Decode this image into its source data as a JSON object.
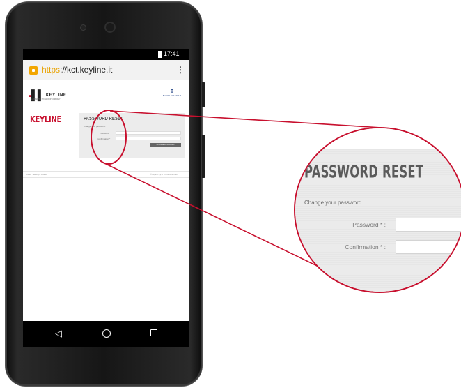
{
  "status_bar": {
    "time": "17:41"
  },
  "browser": {
    "url_protocol": "https",
    "url_rest": "://kct.keyline.it",
    "menu_icon": "more-vert-icon",
    "lock_icon": "lock-icon"
  },
  "site": {
    "logo_text": "KEYLINE",
    "logo_subtitle": "A BIANCHI 1770 GROUP COMPANY",
    "partner_logo": "BIANCHI 1770 GROUP",
    "brand_heading": "KEYLINE",
    "footer_left": "Privacy · Sitemap · Credits",
    "footer_right": "© Keyline S.p.A. · IT 01234567890"
  },
  "form": {
    "title": "PASSWORD RESET",
    "subtitle": "Change your password.",
    "password_label": "Password * :",
    "confirmation_label": "Confirmation * :",
    "password_value": "",
    "confirmation_value": "",
    "submit_label": "CHANGE PASSWORD"
  },
  "nav": {
    "back_icon": "back-icon",
    "home_icon": "home-icon",
    "recents_icon": "recents-icon"
  },
  "colors": {
    "accent_red": "#c8102e",
    "https_orange": "#e8a200",
    "panel_gray": "#ececec"
  }
}
